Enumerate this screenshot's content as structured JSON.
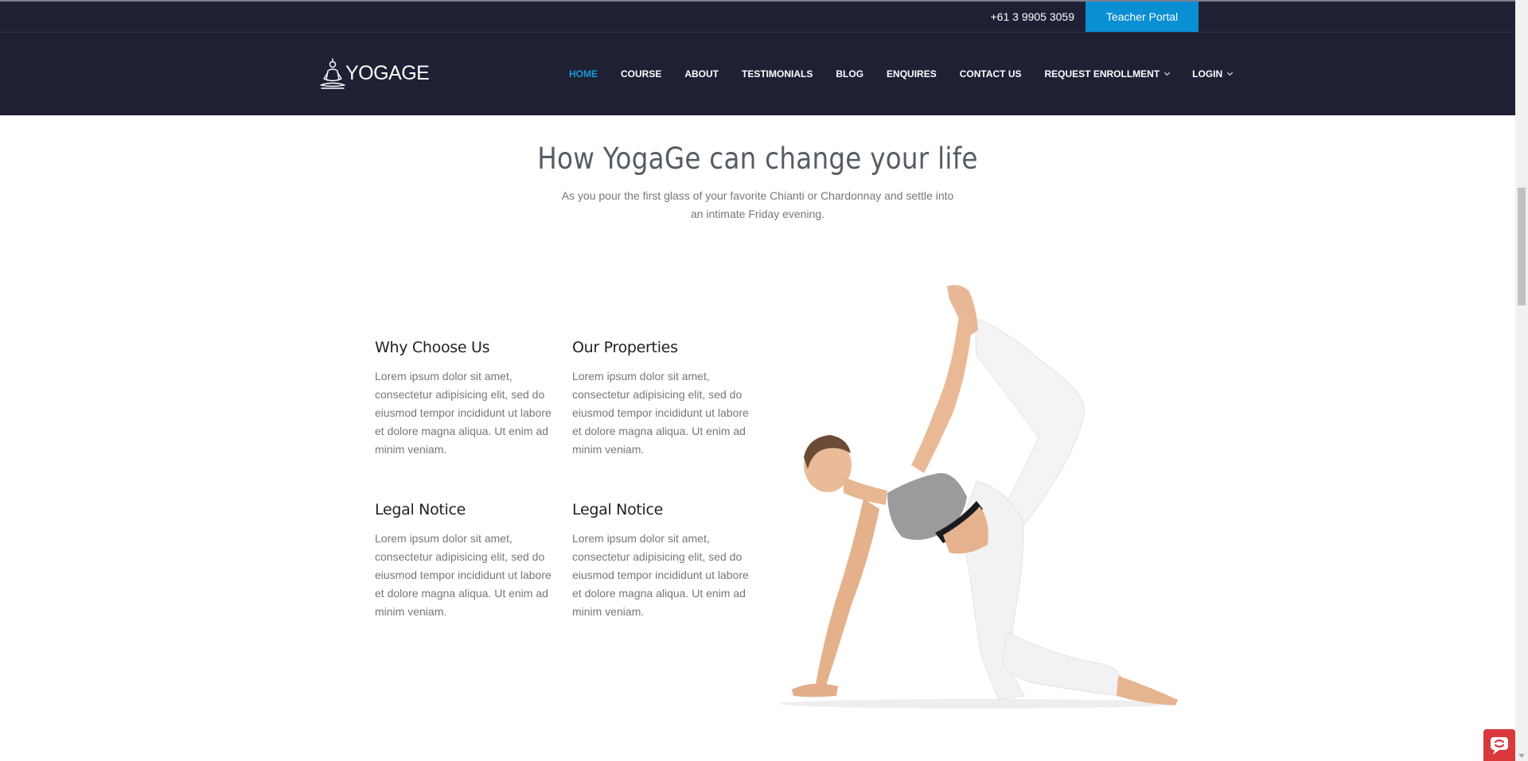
{
  "topbar": {
    "phone": "+61 3 9905 3059",
    "portal_label": "Teacher Portal"
  },
  "header": {
    "logo_text": "YOGAGE",
    "nav": [
      {
        "label": "HOME",
        "active": true
      },
      {
        "label": "COURSE"
      },
      {
        "label": "ABOUT"
      },
      {
        "label": "TESTIMONIALS"
      },
      {
        "label": "BLOG"
      },
      {
        "label": "ENQUIRES"
      },
      {
        "label": "CONTACT US"
      },
      {
        "label": "REQUEST ENROLLMENT",
        "dropdown": true
      },
      {
        "label": "LOGIN",
        "dropdown": true
      }
    ]
  },
  "section": {
    "title": "How YogaGe can change your life",
    "subtitle": "As you pour the first glass of your favorite Chianti or Chardonnay and settle into an intimate Friday evening.",
    "features": [
      {
        "title": "Why Choose Us",
        "text": "Lorem ipsum dolor sit amet, consectetur adipisicing elit, sed do eiusmod tempor incididunt ut labore et dolore magna aliqua. Ut enim ad minim veniam."
      },
      {
        "title": "Our Properties",
        "text": "Lorem ipsum dolor sit amet, consectetur adipisicing elit, sed do eiusmod tempor incididunt ut labore et dolore magna aliqua. Ut enim ad minim veniam."
      },
      {
        "title": "Legal Notice",
        "text": "Lorem ipsum dolor sit amet, consectetur adipisicing elit, sed do eiusmod tempor incididunt ut labore et dolore magna aliqua. Ut enim ad minim veniam."
      },
      {
        "title": "Legal Notice",
        "text": "Lorem ipsum dolor sit amet, consectetur adipisicing elit, sed do eiusmod tempor incididunt ut labore et dolore magna aliqua. Ut enim ad minim veniam."
      }
    ]
  },
  "colors": {
    "header_bg": "#1e2134",
    "accent": "#1a97d8",
    "portal_button": "#0a8fd4",
    "chat_widget": "#d9383d"
  },
  "icons": {
    "logo": "meditation-figure-icon",
    "chat": "chat-widget-icon"
  }
}
